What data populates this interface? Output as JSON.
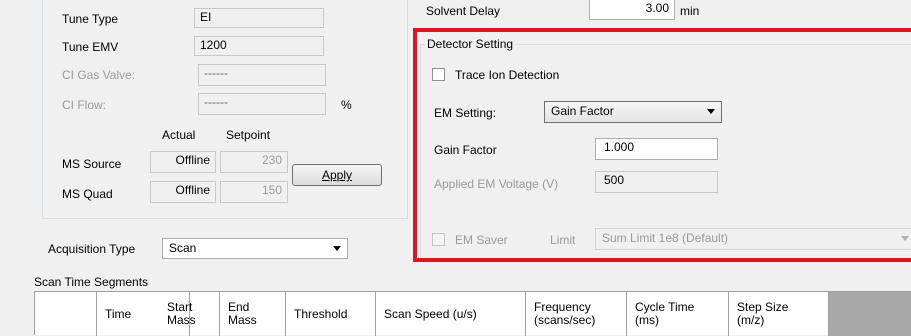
{
  "ms_params": {
    "tune_type": {
      "label": "Tune Type",
      "value": "EI"
    },
    "tune_emv": {
      "label": "Tune EMV",
      "value": "1200"
    },
    "ci_gas_valve": {
      "label": "CI Gas Valve:",
      "value": "------"
    },
    "ci_flow": {
      "label": "CI Flow:",
      "value": "------",
      "unit": "%"
    },
    "col_actual": "Actual",
    "col_setpoint": "Setpoint",
    "ms_source": {
      "label": "MS Source",
      "actual": "Offline",
      "setpoint": "230"
    },
    "ms_quad": {
      "label": "MS Quad",
      "actual": "Offline",
      "setpoint": "150"
    },
    "apply_label": "Apply"
  },
  "acquisition": {
    "label": "Acquisition Type",
    "value": "Scan"
  },
  "solvent_delay": {
    "label": "Solvent Delay",
    "value": "3.00",
    "unit": "min"
  },
  "detector": {
    "group_title": "Detector Setting",
    "trace_ion_label": "Trace Ion Detection",
    "trace_ion_checked": false,
    "em_setting_label": "EM Setting:",
    "em_setting_value": "Gain Factor",
    "gain_factor_label": "Gain Factor",
    "gain_factor_value": "1.000",
    "applied_em_label": "Applied EM Voltage (V)",
    "applied_em_value": "500",
    "em_saver_label": "EM Saver",
    "limit_label": "Limit",
    "limit_value": "Sum Limit 1e8 (Default)",
    "highlight_color": "#e0141e"
  },
  "segments": {
    "title": "Scan Time Segments",
    "headers": {
      "time": "Time",
      "start_mass": "Start\nMass",
      "end_mass": "End\nMass",
      "threshold": "Threshold",
      "scan_speed": "Scan Speed (u/s)",
      "frequency": "Frequency\n(scans/sec)",
      "cycle_time": "Cycle Time\n(ms)",
      "step_size": "Step Size\n(m/z)"
    }
  }
}
